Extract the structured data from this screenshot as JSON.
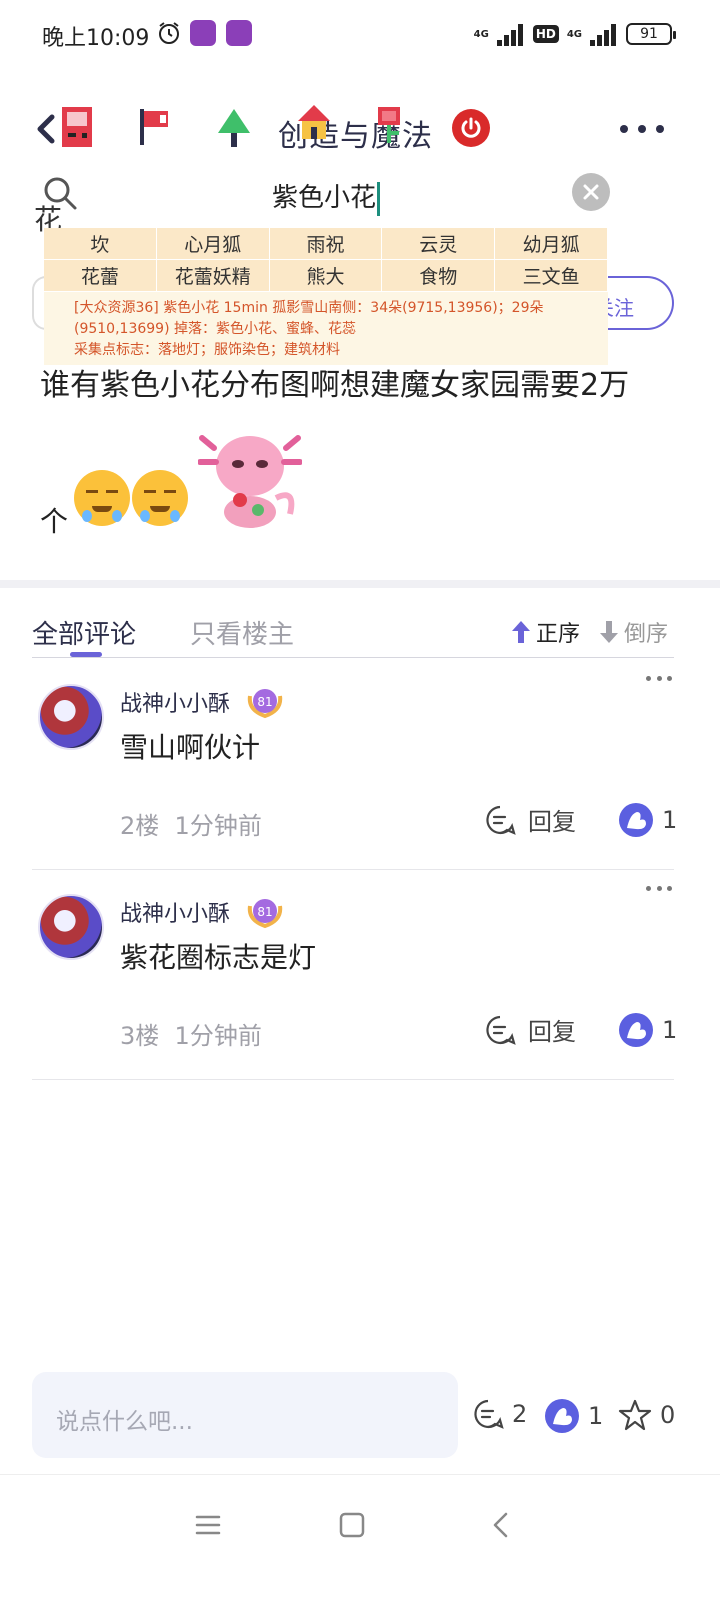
{
  "status_bar": {
    "time": "晚上10:09",
    "net1": "4G",
    "hd": "HD",
    "net2": "4G",
    "battery": "91"
  },
  "title_bar": {
    "title": "创造与魔法"
  },
  "search": {
    "value": "紫色小花",
    "side_char": "花"
  },
  "suggestions": {
    "row1": [
      "坎",
      "心月狐",
      "雨祝",
      "云灵",
      "幼月狐"
    ],
    "row2": [
      "花蕾",
      "花蕾妖精",
      "熊大",
      "食物",
      "三文鱼"
    ],
    "info_line1": "[大众资源36] 紫色小花 15min 孤影雪山南侧：34朵(9715,13956)；29朵",
    "info_line2": "(9510,13699) 掉落：紫色小花、蜜蜂、花蕊",
    "info_line3": "采集点标志：落地灯；服饰染色；建筑材料"
  },
  "follow_label": "关注",
  "post": {
    "text": "谁有紫色小花分布图啊想建魔女家园需要2万",
    "line2": "个"
  },
  "tabs": {
    "all_comments": "全部评论",
    "op_only": "只看楼主",
    "sort_asc": "正序",
    "sort_desc": "倒序"
  },
  "comments": [
    {
      "username": "战神小小酥",
      "level": "81",
      "text": "雪山啊伙计",
      "floor": "2楼",
      "time": "1分钟前",
      "reply_label": "回复",
      "likes": "1"
    },
    {
      "username": "战神小小酥",
      "level": "81",
      "text": "紫花圈标志是灯",
      "floor": "3楼",
      "time": "1分钟前",
      "reply_label": "回复",
      "likes": "1"
    }
  ],
  "bottom_bar": {
    "input_placeholder": "说点什么吧...",
    "comment_count": "2",
    "like_count": "1",
    "star_count": "0"
  },
  "colors": {
    "accent": "#6a63d8",
    "power_red": "#d92a2a",
    "info_orange": "#d4552a",
    "suggest_bg": "#fbe8c8"
  }
}
